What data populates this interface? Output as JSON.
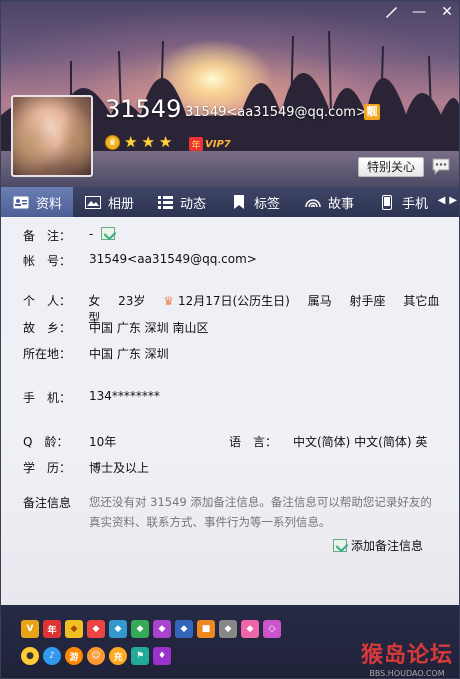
{
  "window": {
    "controls": {
      "skin": "paintbrush-icon",
      "minimize": "—",
      "close": "✕"
    }
  },
  "profile": {
    "nickname": "31549",
    "email_display": "31549<aa31549@qq.com>",
    "pretty_badge": "靓",
    "vip_label": "VIP7",
    "vip_badge": "年",
    "level_stars": 3,
    "special_care_button": "特别关心"
  },
  "tabs": [
    {
      "label": "资料",
      "icon": "profile-card-icon",
      "active": true
    },
    {
      "label": "相册",
      "icon": "album-icon",
      "active": false
    },
    {
      "label": "动态",
      "icon": "feed-icon",
      "active": false
    },
    {
      "label": "标签",
      "icon": "bookmark-icon",
      "active": false
    },
    {
      "label": "故事",
      "icon": "rainbow-icon",
      "active": false
    },
    {
      "label": "手机",
      "icon": "phone-icon",
      "active": false
    }
  ],
  "info": {
    "remark": {
      "label": "备　注：",
      "value": "-"
    },
    "account": {
      "label": "帐　号：",
      "value": "31549<aa31549@qq.com>"
    },
    "personal": {
      "label": "个　人：",
      "gender": "女",
      "age": "23岁",
      "birthday": "12月17日(公历生日)",
      "zodiac": "属马",
      "constellation": "射手座",
      "blood": "其它血型"
    },
    "hometown": {
      "label": "故　乡：",
      "value": "中国 广东 深圳 南山区"
    },
    "location": {
      "label": "所在地：",
      "value": "中国 广东 深圳"
    },
    "mobile": {
      "label": "手　机：",
      "value": "134********"
    },
    "qage": {
      "label": "Q　龄：",
      "value": "10年"
    },
    "language": {
      "label": "语　言：",
      "value": "中文(简体)  中文(简体)  英"
    },
    "education": {
      "label": "学　历：",
      "value": "博士及以上"
    },
    "note": {
      "label": "备注信息",
      "text": "您还没有对 31549 添加备注信息。备注信息可以帮助您记录好友的真实资料、联系方式、事件行为等一系列信息。",
      "add_button": "添加备注信息"
    }
  },
  "footer": {
    "logo_text": "猴岛论坛",
    "logo_sub": "BBS.HOUDAO.COM",
    "row1_icons": [
      "vip-icon",
      "year-icon",
      "diamond-yellow-icon",
      "diamond-red-icon",
      "diamond-blue-icon",
      "diamond-green-icon",
      "diamond-purple-icon",
      "diamond-blue2-icon",
      "gift-icon",
      "diamond-grey-icon",
      "diamond-pink-icon",
      "diamond-gem-icon"
    ],
    "row2_icons": [
      "qzone-icon",
      "music-icon",
      "pet-icon",
      "face-icon",
      "game-icon",
      "flag-icon",
      "purple-icon"
    ]
  }
}
